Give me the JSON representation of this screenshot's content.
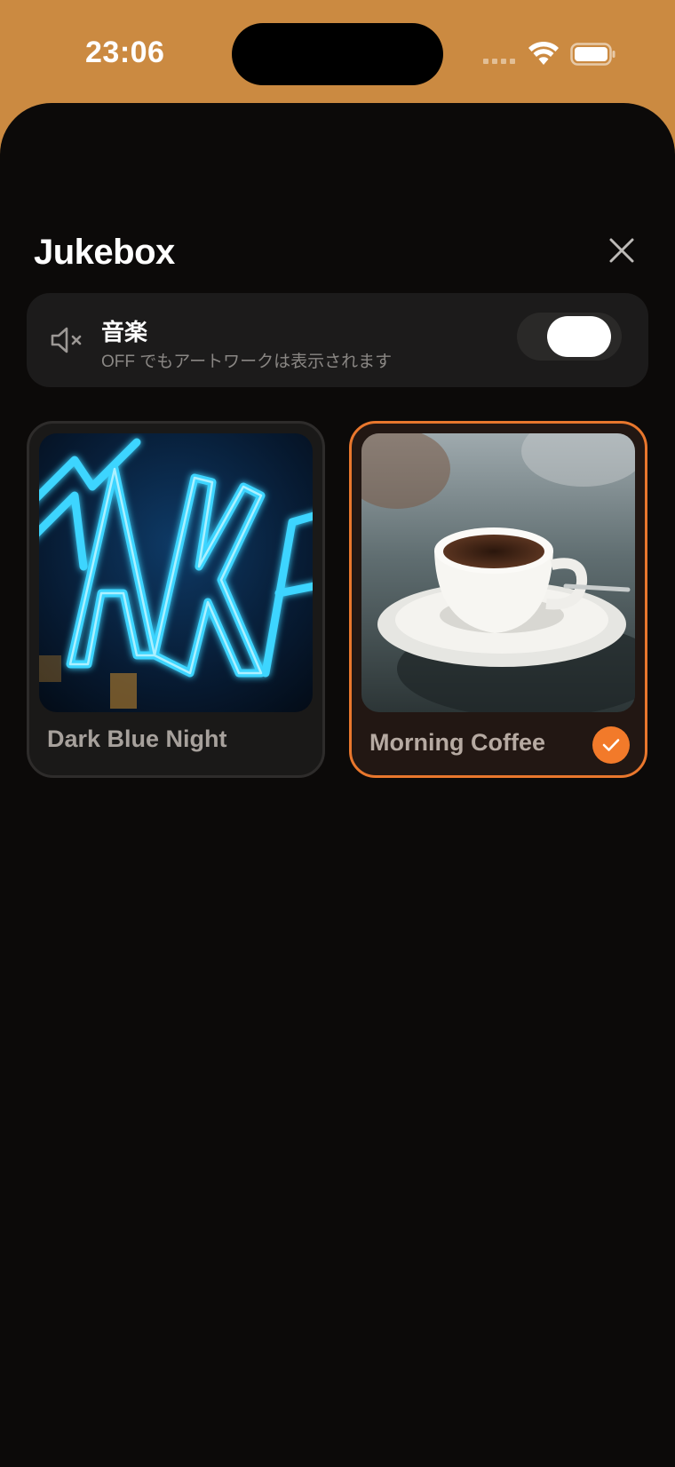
{
  "status_bar": {
    "time": "23:06"
  },
  "sheet": {
    "title": "Jukebox",
    "close_icon": "close-icon"
  },
  "music": {
    "title": "音楽",
    "subtitle": "OFF でもアートワークは表示されます",
    "icon": "speaker-muted-icon",
    "toggle_on": false
  },
  "cards": [
    {
      "label": "Dark Blue Night",
      "selected": false,
      "artwork": "blue-neon-sign"
    },
    {
      "label": "Morning Coffee",
      "selected": true,
      "artwork": "coffee-cup"
    }
  ],
  "colors": {
    "accent": "#F27A2A",
    "header_bg": "#CB8A41",
    "sheet_bg": "#0C0A09",
    "row_bg": "#1C1B1B"
  }
}
